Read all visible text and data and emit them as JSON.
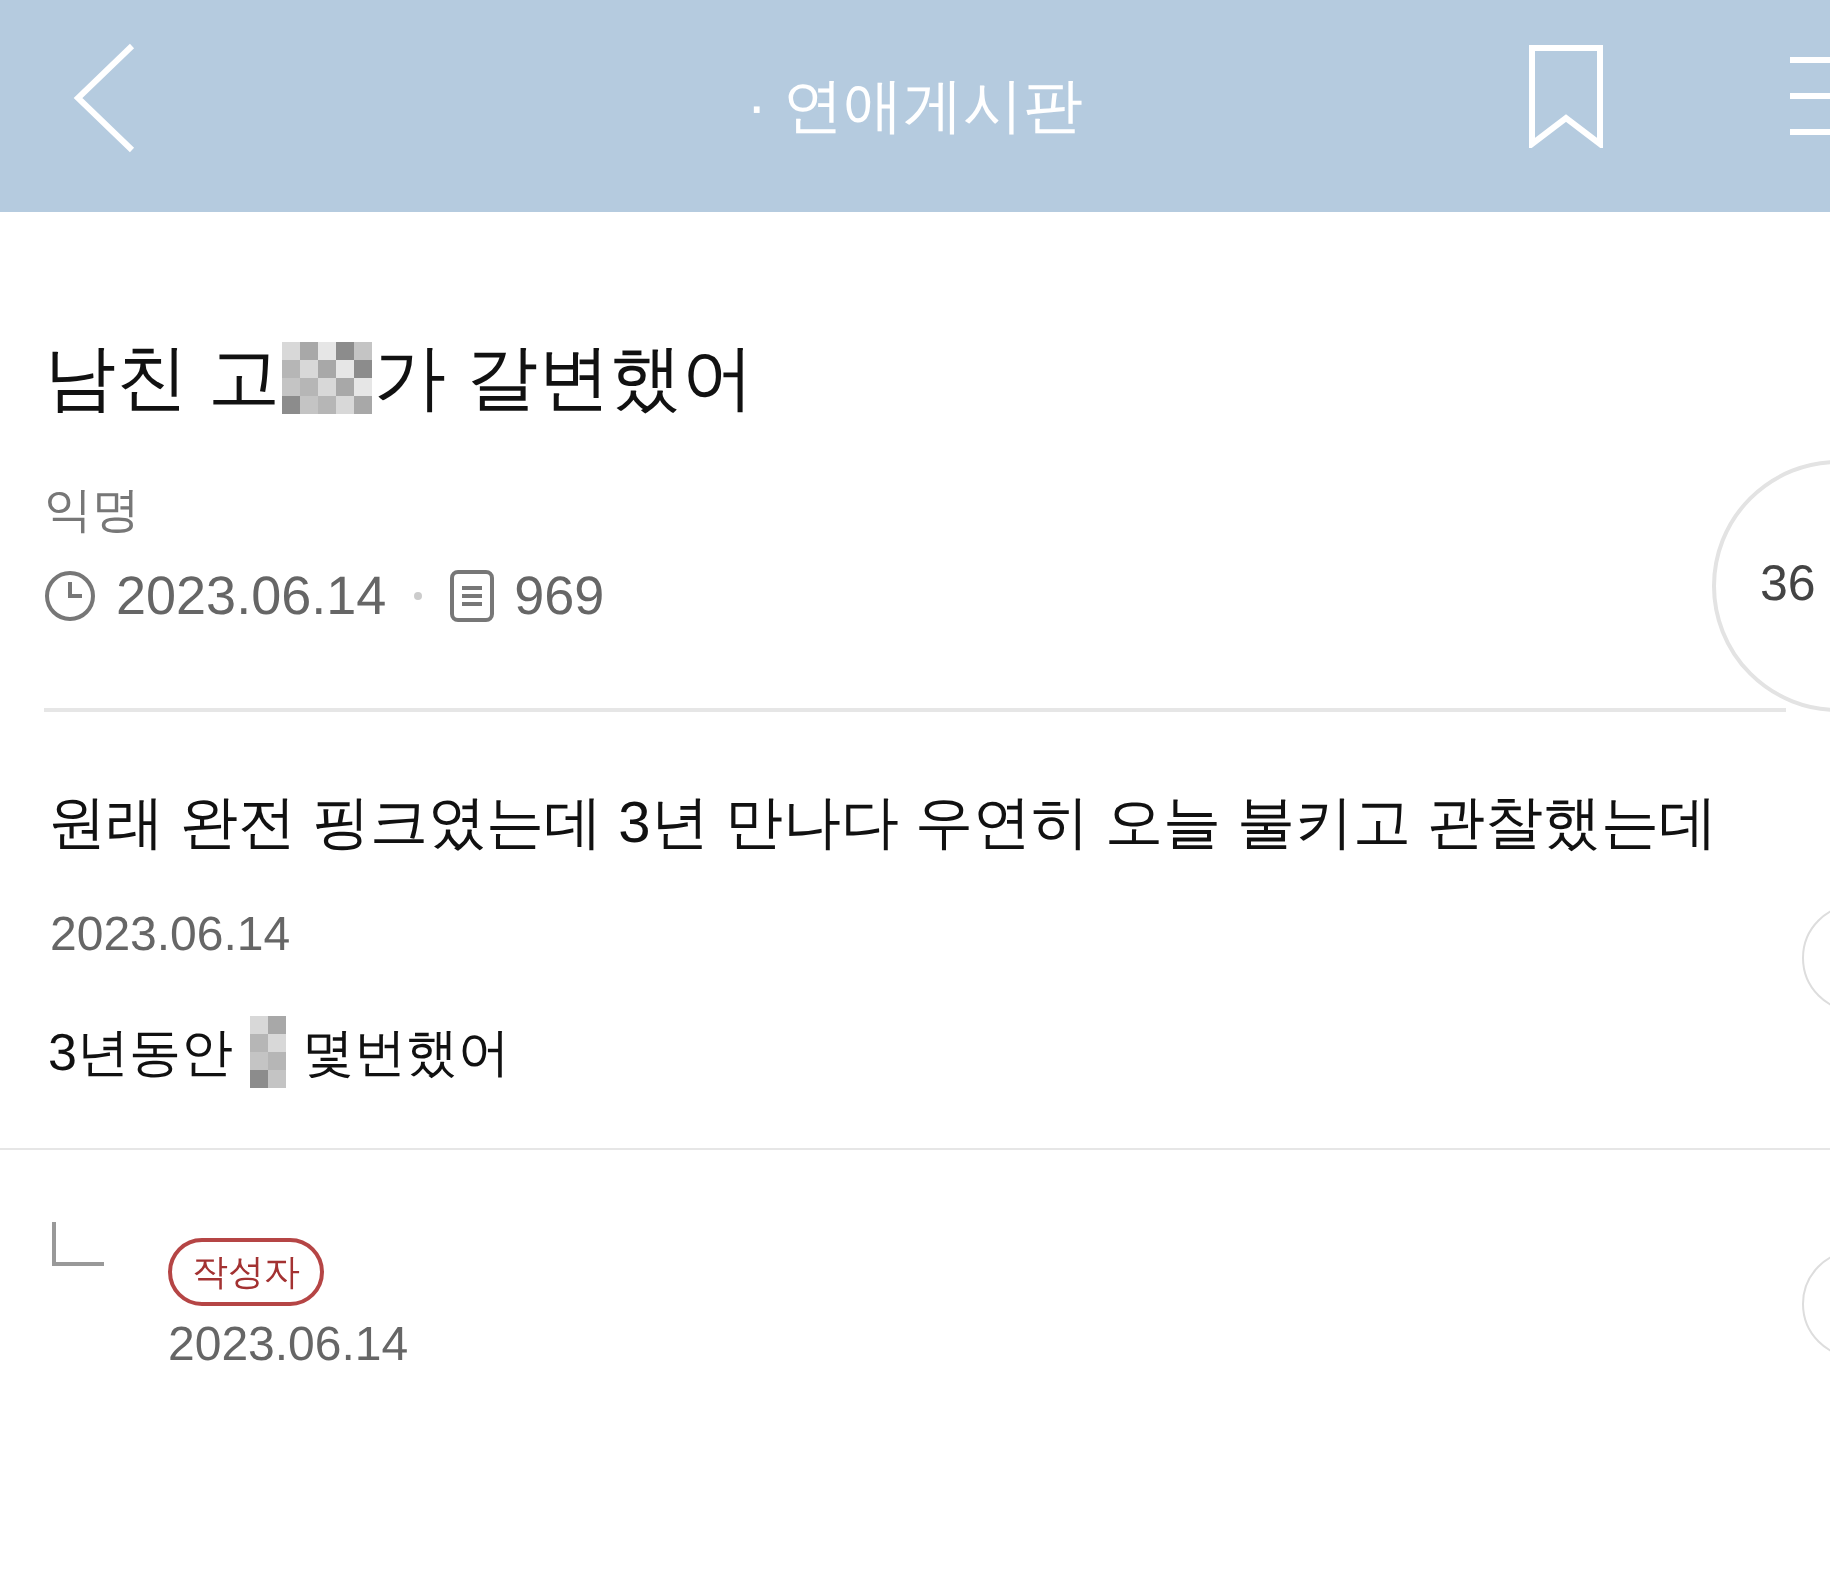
{
  "header": {
    "title": "· 연애게시판"
  },
  "post": {
    "title_before": "남친 고",
    "title_after": "가 갈변했어",
    "author": "익명",
    "date": "2023.06.14",
    "views": "969",
    "like_count": "36"
  },
  "comments": [
    {
      "kind": "comment",
      "text": "원래 완전 핑크였는데 3년 만나다 우연히 오늘 불키고 관찰했는데",
      "date": "2023.06.14",
      "reply_before": "3년동안 ",
      "reply_after": "몇번했어"
    },
    {
      "kind": "reply",
      "badge": "작성자",
      "date": "2023.06.14"
    }
  ]
}
